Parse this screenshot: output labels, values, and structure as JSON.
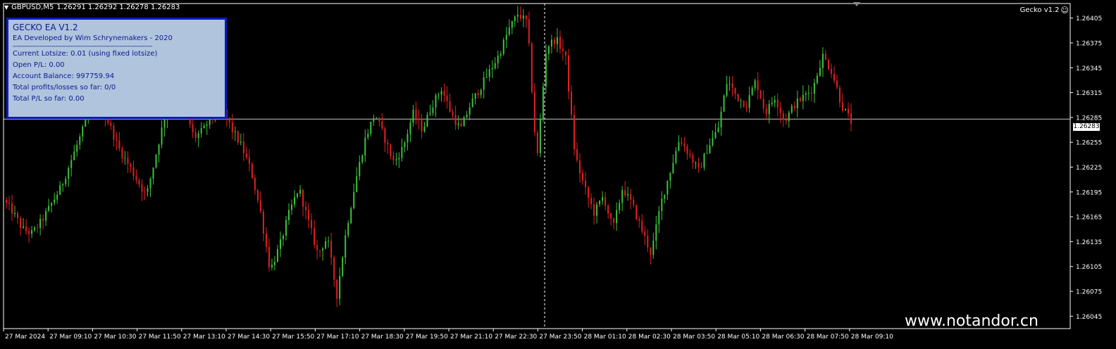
{
  "header": {
    "symbol_label": "GBPUSD,M5",
    "quotes": "1.26291 1.26292 1.26278 1.26283",
    "ea_name": "Gecko v1.2"
  },
  "info_panel": {
    "title": "GECKO EA V1.2",
    "developer": "EA Developed by Wim Schrynemakers - 2020",
    "separator": "------------------------------------------------------------------------",
    "lines": [
      "Current Lotsize: 0.01 (using fixed lotsize)",
      "Open P/L: 0.00",
      "Account Balance: 997759.94",
      "Total profits/losses so far: 0/0",
      "Total P/L so far: 0.00"
    ]
  },
  "current_price": "1.26283",
  "watermark": "www.notandor.cn",
  "colors": {
    "bull": "#3cc43c",
    "bear": "#e02020",
    "background": "#000000",
    "axis": "#ffffff",
    "panel_bg": "#b0c4de",
    "panel_border": "#0b1bbf"
  },
  "chart_data": {
    "type": "candlestick",
    "symbol": "GBPUSD",
    "timeframe": "M5",
    "ylim": [
      1.2603,
      1.2642
    ],
    "y_ticks": [
      "1.26405",
      "1.26375",
      "1.26345",
      "1.26315",
      "1.26285",
      "1.26255",
      "1.26225",
      "1.26195",
      "1.26165",
      "1.26135",
      "1.26105",
      "1.26075",
      "1.26045"
    ],
    "x_ticks": [
      "27 Mar 2024",
      "27 Mar 09:10",
      "27 Mar 10:30",
      "27 Mar 11:50",
      "27 Mar 13:10",
      "27 Mar 14:30",
      "27 Mar 15:50",
      "27 Mar 17:10",
      "27 Mar 18:30",
      "27 Mar 19:50",
      "27 Mar 21:10",
      "27 Mar 22:30",
      "27 Mar 23:50",
      "28 Mar 01:10",
      "28 Mar 02:30",
      "28 Mar 03:50",
      "28 Mar 05:10",
      "28 Mar 06:30",
      "28 Mar 07:50",
      "28 Mar 09:10"
    ],
    "current_price": 1.26283,
    "price_path": [
      1.26185,
      1.2617,
      1.2615,
      1.26145,
      1.2616,
      1.2618,
      1.262,
      1.2623,
      1.2626,
      1.2629,
      1.263,
      1.2628,
      1.2625,
      1.2623,
      1.2621,
      1.2619,
      1.2624,
      1.2629,
      1.2632,
      1.263,
      1.2626,
      1.2627,
      1.2629,
      1.26295,
      1.2627,
      1.2625,
      1.2622,
      1.2617,
      1.261,
      1.2613,
      1.2617,
      1.262,
      1.2616,
      1.2612,
      1.2614,
      1.2607,
      1.2615,
      1.2621,
      1.2626,
      1.2629,
      1.2626,
      1.2623,
      1.2625,
      1.2629,
      1.2627,
      1.263,
      1.2632,
      1.2629,
      1.2627,
      1.263,
      1.2632,
      1.2634,
      1.2636,
      1.2639,
      1.2641,
      1.264,
      1.2623,
      1.2637,
      1.2638,
      1.2636,
      1.2624,
      1.262,
      1.2617,
      1.2619,
      1.2615,
      1.262,
      1.2618,
      1.2615,
      1.2612,
      1.2618,
      1.2622,
      1.2626,
      1.2624,
      1.2622,
      1.2625,
      1.2627,
      1.2633,
      1.2631,
      1.263,
      1.2633,
      1.2629,
      1.2631,
      1.2628,
      1.263,
      1.2631,
      1.2632,
      1.2636,
      1.2634,
      1.263,
      1.2628
    ]
  }
}
